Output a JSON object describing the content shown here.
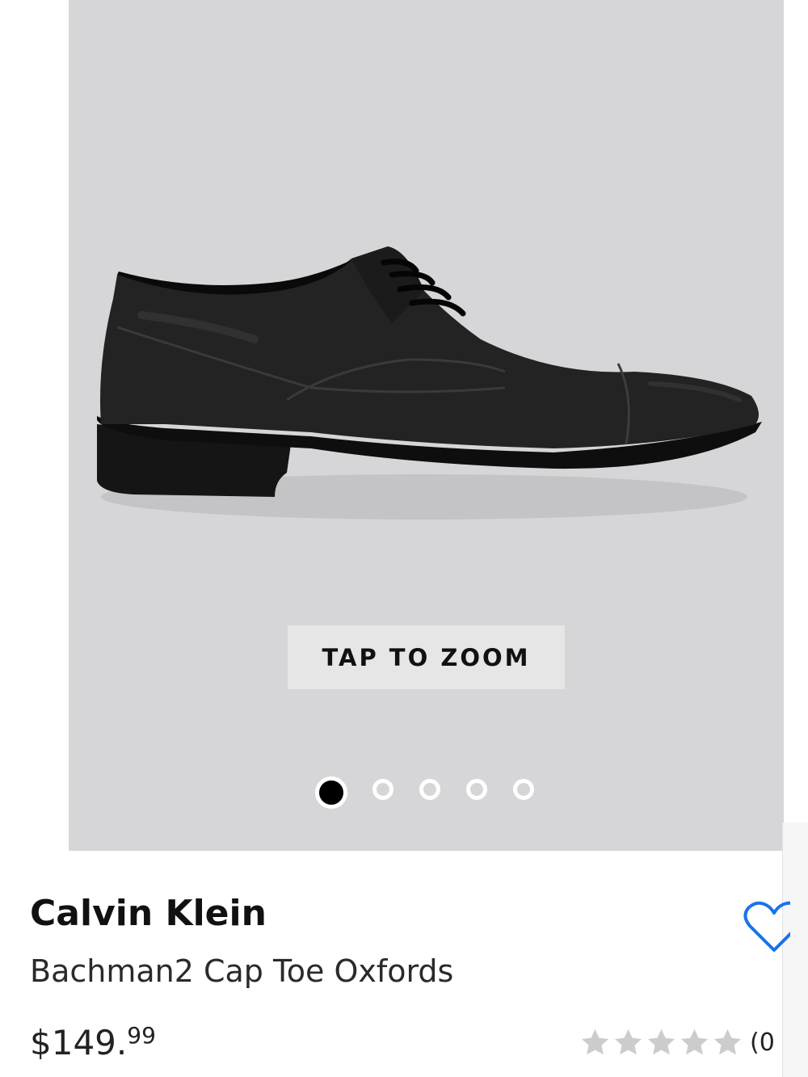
{
  "gallery": {
    "zoom_label": "TAP TO ZOOM",
    "image_count": 5,
    "active_index": 0
  },
  "product": {
    "brand": "Calvin Klein",
    "name": "Bachman2 Cap Toe Oxfords",
    "price_dollars": "$149.",
    "price_cents": "99",
    "rating_value": 0,
    "rating_max": 5,
    "review_count_text": "(0"
  },
  "icons": {
    "favorite": "heart-outline-icon",
    "rating": "star-icon"
  },
  "colors": {
    "image_background": "#d6d6d8",
    "accent": "#1a73e8",
    "star_empty": "#cccccc",
    "dot_active": "#000000"
  }
}
